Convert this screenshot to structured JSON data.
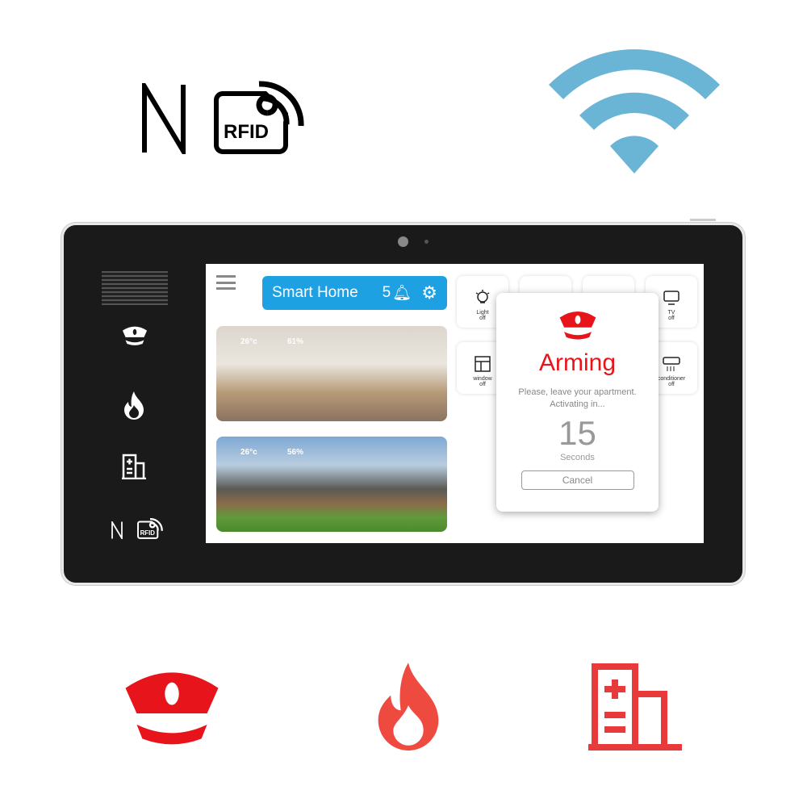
{
  "logos": {
    "nfc": "N",
    "rfid": "RFID"
  },
  "header": {
    "title": "Smart Home",
    "notifications": "5"
  },
  "rooms": [
    {
      "temp": "26°c",
      "humidity": "61%"
    },
    {
      "temp": "26°c",
      "humidity": "56%"
    }
  ],
  "devices": [
    {
      "name": "Light",
      "state": "off",
      "icon": "lightbulb-icon"
    },
    {
      "name": "",
      "state": "",
      "icon": "speaker-icon"
    },
    {
      "name": "",
      "state": "",
      "icon": "fridge-icon"
    },
    {
      "name": "TV",
      "state": "off",
      "icon": "tv-icon"
    },
    {
      "name": "window",
      "state": "off",
      "icon": "window-icon"
    },
    {
      "name": "conditioner",
      "state": "off",
      "icon": "air-conditioner-icon"
    }
  ],
  "popup": {
    "title": "Arming",
    "message": "Please, leave your apartment. Activating in...",
    "countdown": "15",
    "unit": "Seconds",
    "cancel": "Cancel"
  },
  "colors": {
    "accent": "#1ea1e3",
    "alarm": "#e8141b",
    "wifi": "#6ab4d6"
  }
}
